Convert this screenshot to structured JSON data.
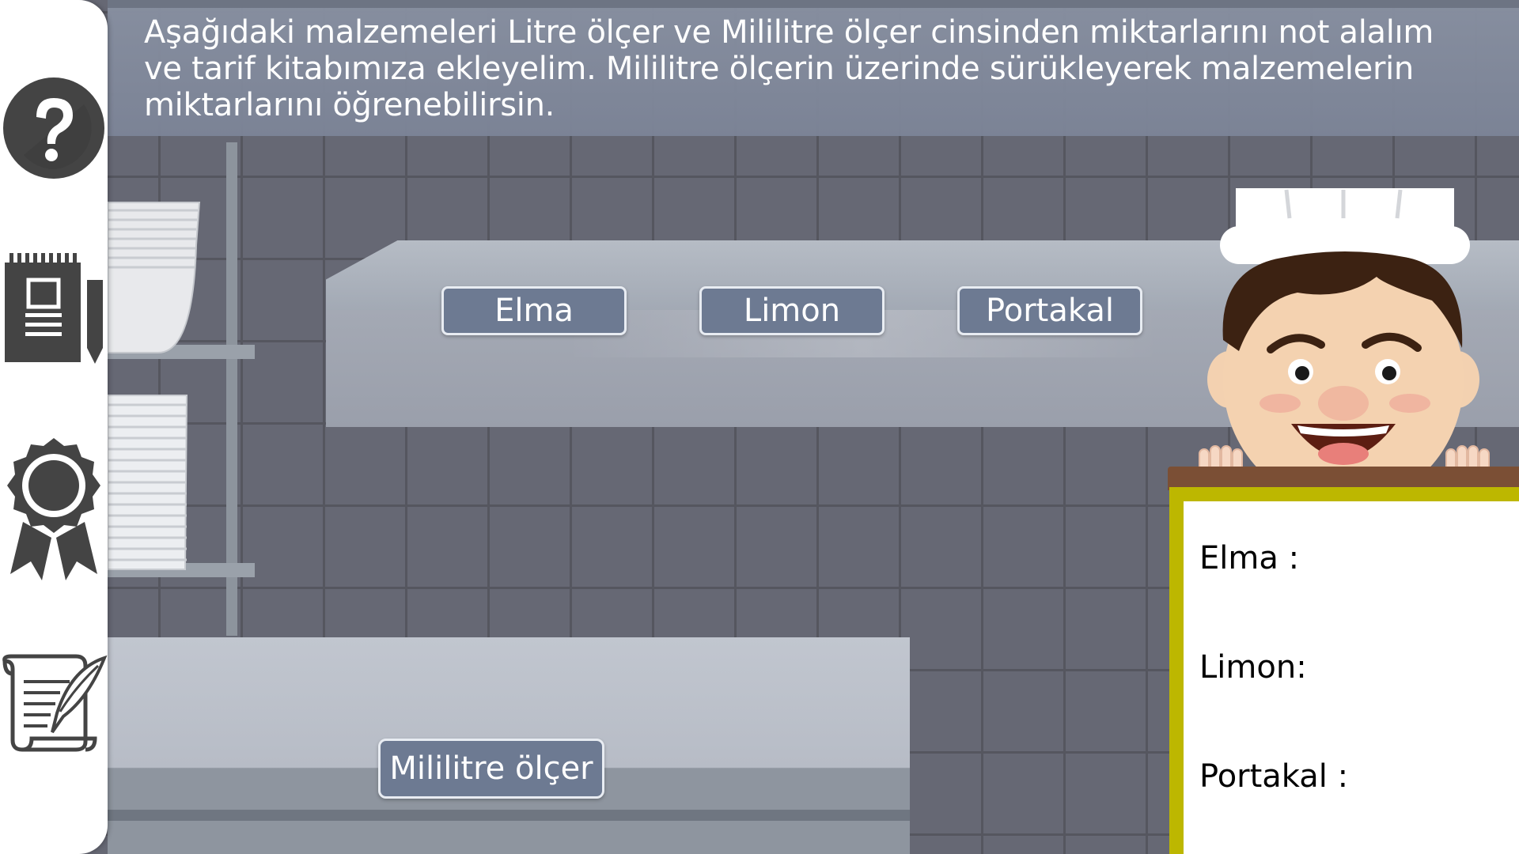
{
  "instruction": "Aşağıdaki malzemeleri Litre ölçer ve Mililitre ölçer cinsinden miktarlarını not alalım\nve tarif kitabımıza ekleyelim.  Mililitre ölçerin üzerinde sürükleyerek malzemelerin\nmiktarlarını öğrenebilirsin.",
  "sidebar": {
    "items": [
      {
        "icon": "help-icon"
      },
      {
        "icon": "notebook-icon"
      },
      {
        "icon": "award-icon"
      },
      {
        "icon": "script-quill-icon"
      }
    ]
  },
  "ingredients": [
    "Elma",
    "Limon",
    "Portakal"
  ],
  "measure_button": "Mililitre ölçer",
  "board": {
    "lines": [
      "Elma :",
      "Limon:",
      "Portakal :"
    ]
  },
  "colors": {
    "button_fill": "#6d7a92",
    "button_border": "#e8ecf2",
    "board_frame": "#bdb700",
    "banner": "#8890a1"
  }
}
